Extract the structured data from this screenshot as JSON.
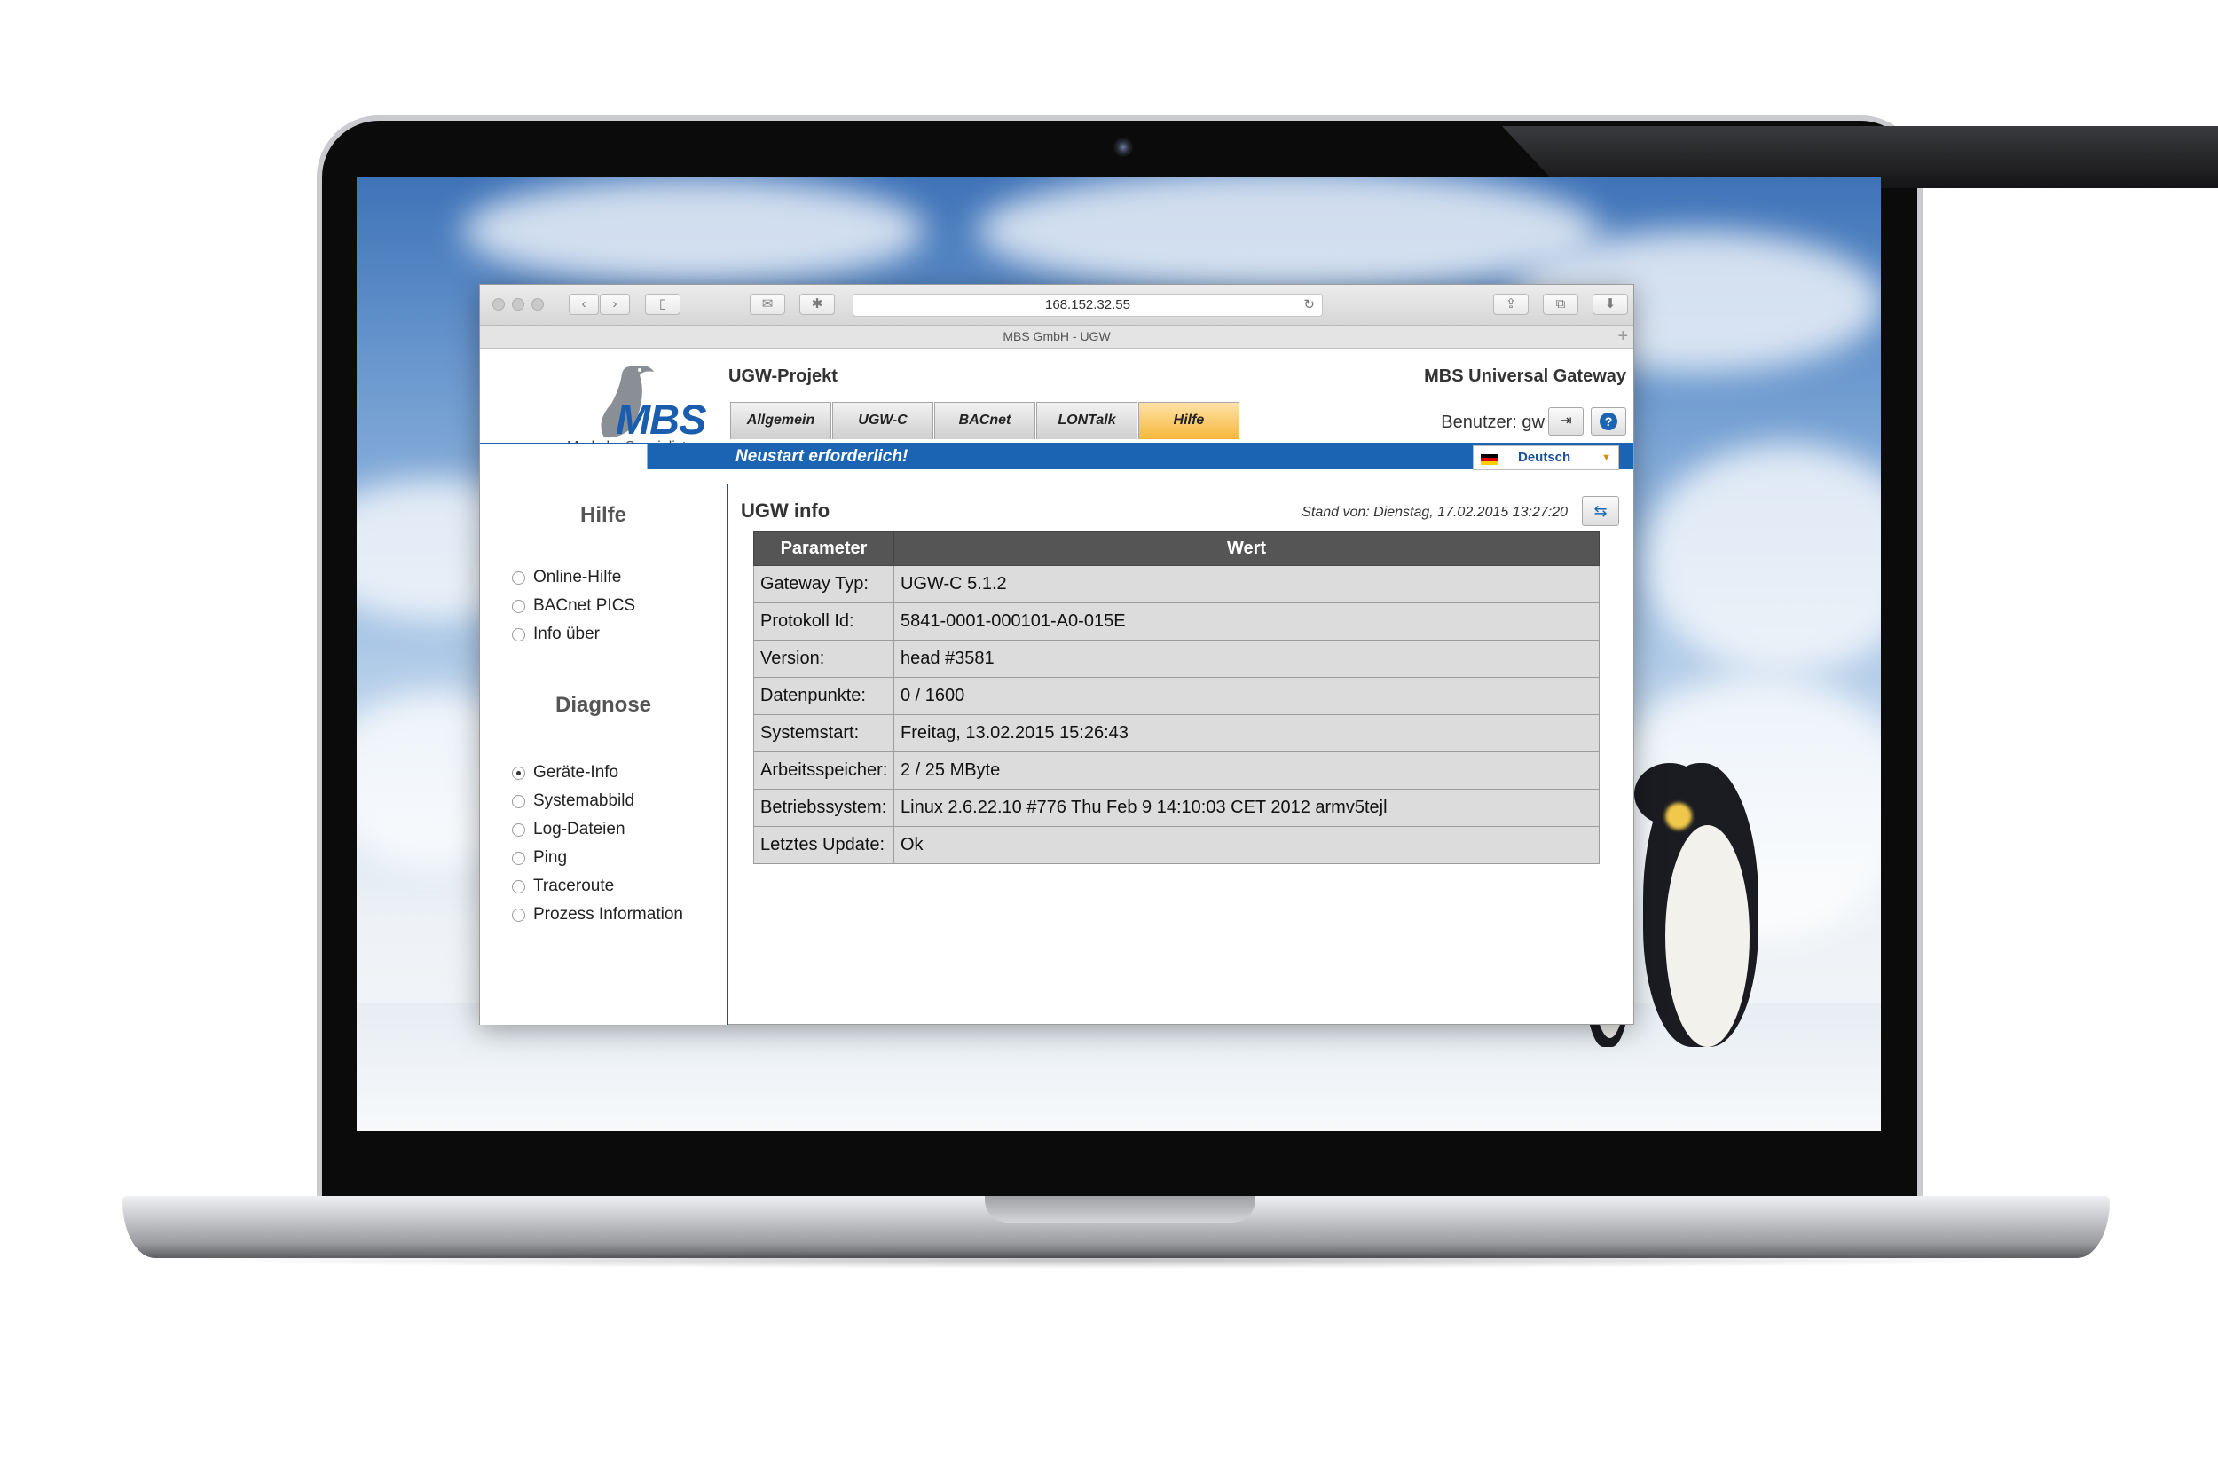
{
  "browser": {
    "url": "168.152.32.55",
    "tab_title": "MBS GmbH - UGW"
  },
  "brand": {
    "logo_text": "MBS",
    "tagline": "Made by Specialists."
  },
  "header": {
    "project": "UGW-Projekt",
    "product": "MBS Universal Gateway",
    "tabs": [
      "Allgemein",
      "UGW-C",
      "BACnet",
      "LONTalk",
      "Hilfe"
    ],
    "active_tab": "Hilfe",
    "user_label": "Benutzer:",
    "user_name": "gw",
    "notice": "Neustart erforderlich!",
    "language": "Deutsch"
  },
  "sidebar": {
    "help_title": "Hilfe",
    "help_items": [
      "Online-Hilfe",
      "BACnet PICS",
      "Info über"
    ],
    "diag_title": "Diagnose",
    "diag_items": [
      "Geräte-Info",
      "Systemabbild",
      "Log-Dateien",
      "Ping",
      "Traceroute",
      "Prozess Information"
    ],
    "selected": "Geräte-Info"
  },
  "main": {
    "title": "UGW info",
    "timestamp": "Stand von: Dienstag, 17.02.2015 13:27:20",
    "table": {
      "headers": [
        "Parameter",
        "Wert"
      ],
      "rows": [
        [
          "Gateway Typ:",
          "UGW-C 5.1.2"
        ],
        [
          "Protokoll Id:",
          "5841-0001-000101-A0-015E"
        ],
        [
          "Version:",
          "head #3581"
        ],
        [
          "Datenpunkte:",
          "0 / 1600"
        ],
        [
          "Systemstart:",
          "Freitag, 13.02.2015 15:26:43"
        ],
        [
          "Arbeitsspeicher:",
          "2 / 25 MByte"
        ],
        [
          "Betriebssystem:",
          "Linux 2.6.22.10 #776 Thu Feb 9 14:10:03 CET 2012 armv5tejl"
        ],
        [
          "Letztes Update:",
          "Ok"
        ]
      ]
    }
  },
  "colors": {
    "brand_blue": "#1b64b3",
    "active_tab": "#f6b63a",
    "table_header": "#555555",
    "table_cell": "#dcdcdc"
  }
}
